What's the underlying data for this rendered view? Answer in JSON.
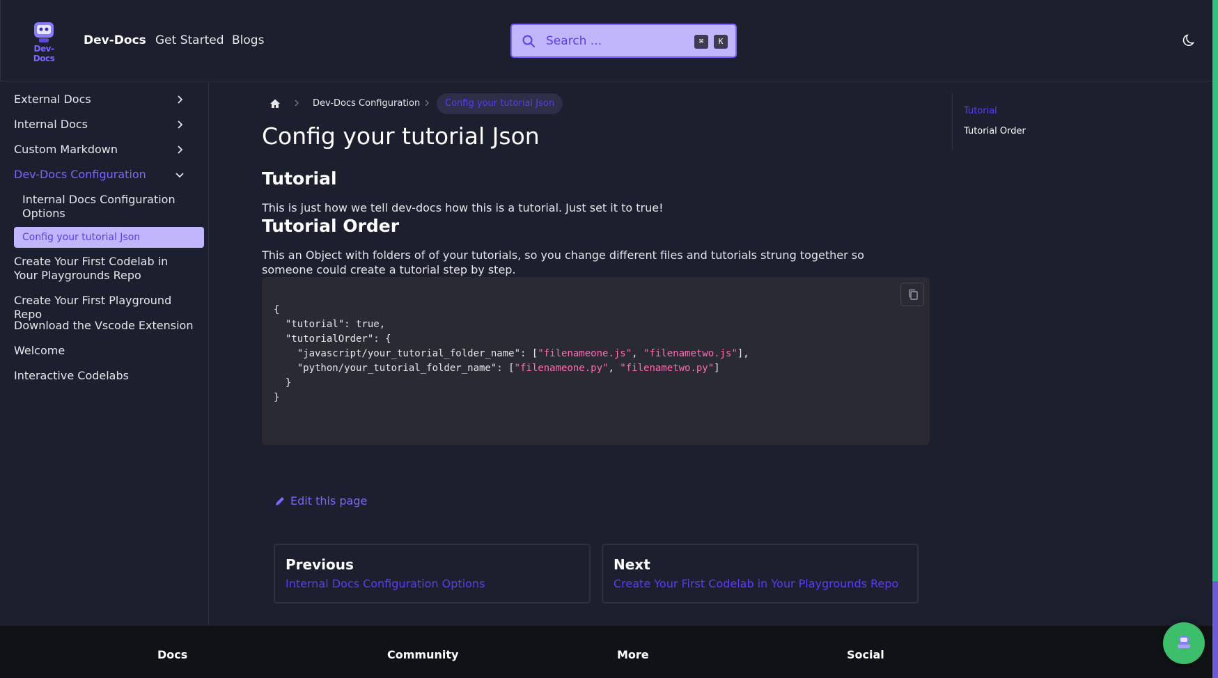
{
  "header": {
    "logo_text": "Dev-Docs",
    "brand": "Dev-Docs",
    "nav": [
      "Get Started",
      "Blogs"
    ],
    "search_placeholder": "Search ...",
    "shortcut_keys": [
      "⌘",
      "K"
    ]
  },
  "sidebar": {
    "categories": [
      "External Docs",
      "Internal Docs",
      "Custom Markdown",
      "Dev-Docs Configuration"
    ],
    "sub_items": [
      "Internal Docs Configuration Options",
      "Config your tutorial Json"
    ],
    "items": [
      "Create Your First Codelab in Your Playgrounds Repo",
      "Create Your First Playground Repo",
      "Download the Vscode Extension",
      "Welcome",
      "Interactive Codelabs"
    ]
  },
  "breadcrumb": {
    "parent": "Dev-Docs Configuration",
    "current": "Config your tutorial Json"
  },
  "content": {
    "title": "Config your tutorial Json",
    "section1_heading": "Tutorial",
    "section1_text": "This is just how we tell dev-docs how this is a tutorial. Just set it to true!",
    "section2_heading": "Tutorial Order",
    "section2_text": "This an Object with folders of of your tutorials, so you change different files and tutorials strung together so someone could create a tutorial step by step.",
    "code_lines": [
      "{",
      "  \"tutorial\": true,",
      "  \"tutorialOrder\": {",
      "    \"javascript/your_tutorial_folder_name\": [\"filenameone.js\", \"filenametwo.js\"],",
      "    \"python/your_tutorial_folder_name\": [\"filenameone.py\", \"filenametwo.py\"]",
      "  }",
      "}"
    ],
    "edit_label": "Edit this page"
  },
  "pagination": {
    "prev_label": "Previous",
    "prev_title": "Internal Docs Configuration Options",
    "next_label": "Next",
    "next_title": "Create Your First Codelab in Your Playgrounds Repo"
  },
  "toc": [
    "Tutorial",
    "Tutorial Order"
  ],
  "footer": [
    "Docs",
    "Community",
    "More",
    "Social"
  ],
  "colors": {
    "accent": "#7c66ff",
    "accent_dark": "#5a3df0",
    "background": "#1b1f2e",
    "code_string": "#ff6bb3",
    "footer_bg": "#101216",
    "chat_button": "#3dbe6a"
  }
}
